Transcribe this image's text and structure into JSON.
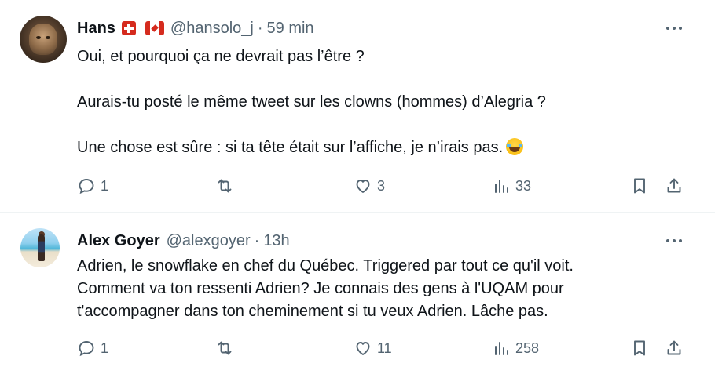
{
  "tweets": [
    {
      "name": "Hans",
      "flags": [
        "swiss-flag",
        "canada-flag"
      ],
      "handle": "@hansolo_j",
      "separator": "·",
      "time": "59 min",
      "body": [
        "Oui, et pourquoi ça ne devrait pas l’être ?",
        "Aurais-tu posté le même tweet sur les clowns (hommes) d’Alegria ?",
        "Une chose est sûre : si ta tête était sur l’affiche, je n’irais pas."
      ],
      "emoji": "face-with-tears-of-joy",
      "replies": "1",
      "retweets": "",
      "likes": "3",
      "views": "33"
    },
    {
      "name": "Alex Goyer",
      "handle": "@alexgoyer",
      "separator": "·",
      "time": "13h",
      "body": [
        "Adrien, le snowflake en chef du Québec. Triggered par tout ce qu'il voit.",
        "Comment va ton ressenti Adrien? Je connais des gens à l'UQAM pour",
        "t'accompagner dans ton cheminement si tu veux Adrien. Lâche pas."
      ],
      "replies": "1",
      "retweets": "",
      "likes": "11",
      "views": "258"
    }
  ],
  "icons": {
    "reply": "reply-icon",
    "retweet": "retweet-icon",
    "like": "heart-icon",
    "views": "views-icon",
    "bookmark": "bookmark-icon",
    "share": "share-icon",
    "more": "more-icon"
  },
  "colors": {
    "text": "#0f1419",
    "muted": "#536471",
    "divider": "#eff3f4"
  }
}
